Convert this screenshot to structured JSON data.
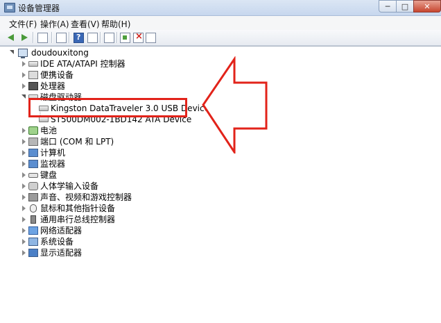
{
  "window": {
    "title": "设备管理器",
    "buttons": {
      "minimize": "─",
      "maximize": "□",
      "close": "✕"
    }
  },
  "menu": [
    "文件(F)",
    "操作(A)",
    "查看(V)",
    "帮助(H)"
  ],
  "toolbar": {
    "icons": [
      "back-arrow-icon",
      "forward-arrow-icon",
      "console-tree-icon",
      "properties-icon",
      "help-icon",
      "scan-icon",
      "update-driver-icon",
      "disable-icon",
      "uninstall-icon"
    ]
  },
  "tree": {
    "root": "doudouxitong",
    "categories": [
      {
        "label": "IDE ATA/ATAPI 控制器",
        "icon": "ide-controller-icon",
        "expanded": false
      },
      {
        "label": "便携设备",
        "icon": "portable-device-icon",
        "expanded": false
      },
      {
        "label": "处理器",
        "icon": "processor-icon",
        "expanded": false
      },
      {
        "label": "磁盘驱动器",
        "icon": "disk-drive-icon",
        "expanded": true,
        "children": [
          "Kingston DataTraveler 3.0 USB Device",
          "ST500DM002-1BD142 ATA Device"
        ]
      },
      {
        "label": "电池",
        "icon": "battery-icon",
        "expanded": false
      },
      {
        "label": "端口 (COM 和 LPT)",
        "icon": "port-icon",
        "expanded": false
      },
      {
        "label": "计算机",
        "icon": "computer-icon",
        "expanded": false
      },
      {
        "label": "监视器",
        "icon": "monitor-icon",
        "expanded": false
      },
      {
        "label": "键盘",
        "icon": "keyboard-icon",
        "expanded": false
      },
      {
        "label": "人体学输入设备",
        "icon": "hid-icon",
        "expanded": false
      },
      {
        "label": "声音、视频和游戏控制器",
        "icon": "sound-icon",
        "expanded": false
      },
      {
        "label": "鼠标和其他指针设备",
        "icon": "mouse-icon",
        "expanded": false
      },
      {
        "label": "通用串行总线控制器",
        "icon": "usb-icon",
        "expanded": false
      },
      {
        "label": "网络适配器",
        "icon": "network-adapter-icon",
        "expanded": false
      },
      {
        "label": "系统设备",
        "icon": "system-device-icon",
        "expanded": false
      },
      {
        "label": "显示适配器",
        "icon": "display-adapter-icon",
        "expanded": false
      }
    ]
  },
  "annotation": {
    "highlight_color": "#e2231a"
  }
}
